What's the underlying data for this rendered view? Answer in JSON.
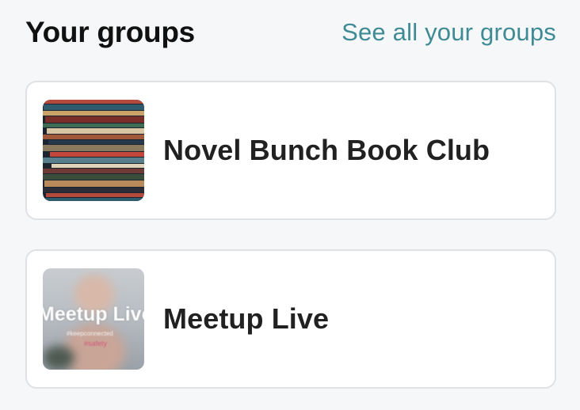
{
  "header": {
    "title": "Your groups",
    "see_all_label": "See all your groups"
  },
  "groups": [
    {
      "name": "Novel Bunch Book Club",
      "thumbnail_icon": "books-photo"
    },
    {
      "name": "Meetup Live",
      "thumbnail_icon": "meetup-live-photo",
      "thumbnail_caption": "Meetup Live",
      "thumbnail_subcaption": "#keepconnected",
      "thumbnail_subcaption2": "#safety"
    }
  ],
  "colors": {
    "link": "#3f8b95",
    "background": "#f6f7f8",
    "card": "#ffffff",
    "card_border": "#dfe1e4",
    "text": "#212121"
  }
}
